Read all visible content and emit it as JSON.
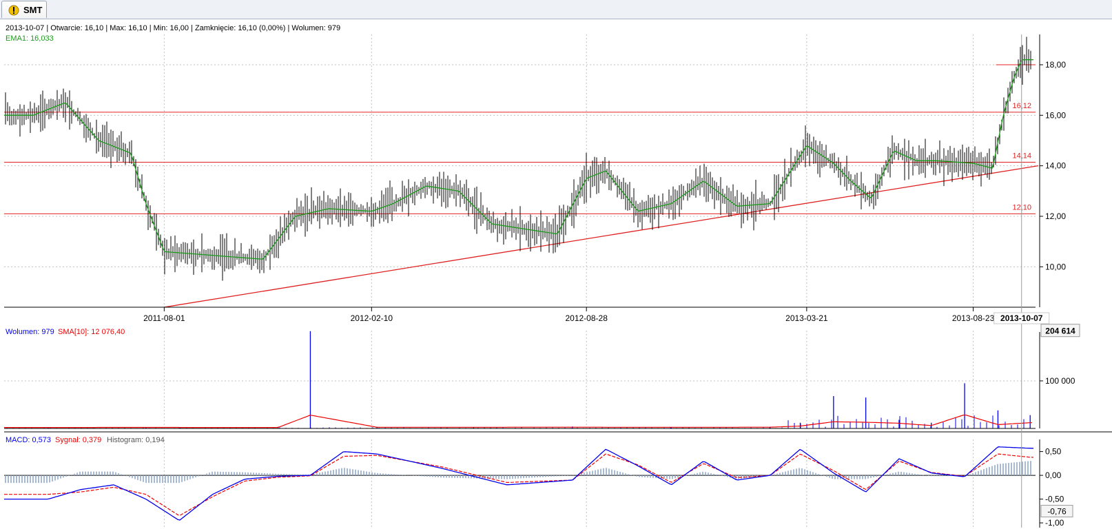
{
  "tab": {
    "label": "SMT"
  },
  "colors": {
    "price_bar": "#000000",
    "ema": "#1a9a1a",
    "resistance": "#e02020",
    "volume": "#0000ee",
    "sma": "#ee0000",
    "macd": "#0000ee",
    "signal": "#ee0000",
    "histogram": "#8fa8cf",
    "grid": "#c0c0c0"
  },
  "price_panel": {
    "info_line": "2013-10-07 | Otwarcie: 16,10 | Max: 16,10 | Min: 16,00 | Zamknięcie: 16,10 (0,00%) | Wolumen: 979",
    "ema_label": "EMA1: 16,033",
    "y_ticks": [
      "10,00",
      "12,00",
      "14,00",
      "16,00",
      "18,00"
    ],
    "x_ticks": [
      "2011-08-01",
      "2012-02-10",
      "2012-08-28",
      "2013-03-21",
      "2013-08-23"
    ],
    "cursor_date": "2013-10-07",
    "h_lines": [
      {
        "label": "16,12",
        "value": 16.12
      },
      {
        "label": "14,14",
        "value": 14.14
      },
      {
        "label": "12,10",
        "value": 12.1
      },
      {
        "label": "",
        "value": 18.0
      }
    ]
  },
  "volume_panel": {
    "label_vol": "Wolumen: 979",
    "label_sma": "SMA[10]: 12 076,40",
    "y_ticks": [
      "100 000"
    ],
    "max_badge": "204 614"
  },
  "macd_panel": {
    "label_macd": "MACD: 0,573",
    "label_signal": "Sygnał: 0,379",
    "label_hist": "Histogram: 0,194",
    "y_ticks": [
      "0,50",
      "0,00",
      "-0,50",
      "-1,00"
    ],
    "cursor_badge": "-0,76"
  },
  "chart_data": [
    {
      "type": "line",
      "title": "SMT",
      "ylim": [
        8.4,
        19.2
      ],
      "x_dates": [
        "2011-04-01",
        "2011-05-01",
        "2011-06-01",
        "2011-07-01",
        "2011-07-15",
        "2011-08-01",
        "2011-09-01",
        "2011-10-01",
        "2011-11-01",
        "2011-12-01",
        "2012-01-01",
        "2012-02-10",
        "2012-03-01",
        "2012-04-01",
        "2012-05-01",
        "2012-06-01",
        "2012-07-01",
        "2012-08-01",
        "2012-08-28",
        "2012-09-15",
        "2012-10-15",
        "2012-11-15",
        "2012-12-15",
        "2013-01-15",
        "2013-02-15",
        "2013-03-21",
        "2013-04-15",
        "2013-05-01",
        "2013-05-20",
        "2013-06-10",
        "2013-07-01",
        "2013-07-20",
        "2013-08-23",
        "2013-09-10",
        "2013-09-20",
        "2013-09-30",
        "2013-10-07"
      ],
      "series": [
        {
          "name": "EMA1",
          "values": [
            16.0,
            16.5,
            15.0,
            14.5,
            12.5,
            10.6,
            10.5,
            10.4,
            10.3,
            12.0,
            12.3,
            12.2,
            12.5,
            13.2,
            13.0,
            11.7,
            11.5,
            11.3,
            13.5,
            13.8,
            12.2,
            12.5,
            13.4,
            12.4,
            12.5,
            14.8,
            14.1,
            13.4,
            12.7,
            14.6,
            14.2,
            14.2,
            14.1,
            13.9,
            16.0,
            17.5,
            18.2
          ]
        }
      ]
    },
    {
      "type": "bar",
      "title": "Wolumen",
      "categories": [
        "2011-04",
        "2011-07",
        "2011-08",
        "2011-11",
        "2011-12",
        "2012-02",
        "2012-05",
        "2012-08",
        "2012-11",
        "2013-02",
        "2013-03",
        "2013-04",
        "2013-05",
        "2013-06",
        "2013-07",
        "2013-08",
        "2013-09",
        "2013-10"
      ],
      "series": [
        {
          "name": "Wolumen",
          "values": [
            2000,
            2500,
            1500,
            2200,
            204614,
            3000,
            2800,
            4000,
            2500,
            3500,
            12000,
            68000,
            65000,
            18000,
            12000,
            95000,
            38000,
            28000
          ]
        },
        {
          "name": "SMA[10]",
          "values": [
            2000,
            2200,
            2100,
            2000,
            28000,
            2500,
            2500,
            2600,
            2400,
            2600,
            5000,
            14000,
            13000,
            11000,
            6000,
            29000,
            8000,
            12076.4
          ]
        }
      ],
      "ylim": [
        0,
        210000
      ]
    },
    {
      "type": "line",
      "title": "MACD",
      "x_dates": [
        "2011-04",
        "2011-05",
        "2011-06",
        "2011-07",
        "2011-08",
        "2011-09",
        "2011-10",
        "2011-11",
        "2011-12",
        "2012-01",
        "2012-02",
        "2012-04",
        "2012-06",
        "2012-08",
        "2012-09",
        "2012-10",
        "2012-11",
        "2012-12",
        "2013-01",
        "2013-02",
        "2013-03",
        "2013-04",
        "2013-05",
        "2013-06",
        "2013-07",
        "2013-08",
        "2013-09",
        "2013-10"
      ],
      "series": [
        {
          "name": "MACD",
          "values": [
            -0.5,
            -0.3,
            -0.2,
            -0.5,
            -0.95,
            -0.4,
            -0.08,
            -0.02,
            0.0,
            0.5,
            0.45,
            0.15,
            -0.2,
            -0.1,
            0.55,
            0.2,
            -0.2,
            0.3,
            -0.1,
            0.0,
            0.55,
            0.05,
            -0.35,
            0.35,
            0.05,
            -0.03,
            0.6,
            0.57
          ]
        },
        {
          "name": "Sygnał",
          "values": [
            -0.4,
            -0.35,
            -0.25,
            -0.4,
            -0.85,
            -0.45,
            -0.12,
            -0.04,
            -0.01,
            0.4,
            0.42,
            0.18,
            -0.15,
            -0.1,
            0.45,
            0.22,
            -0.15,
            0.25,
            -0.05,
            0.0,
            0.45,
            0.1,
            -0.3,
            0.3,
            0.06,
            -0.02,
            0.45,
            0.38
          ]
        }
      ],
      "ylim": [
        -1.1,
        0.9
      ]
    }
  ]
}
